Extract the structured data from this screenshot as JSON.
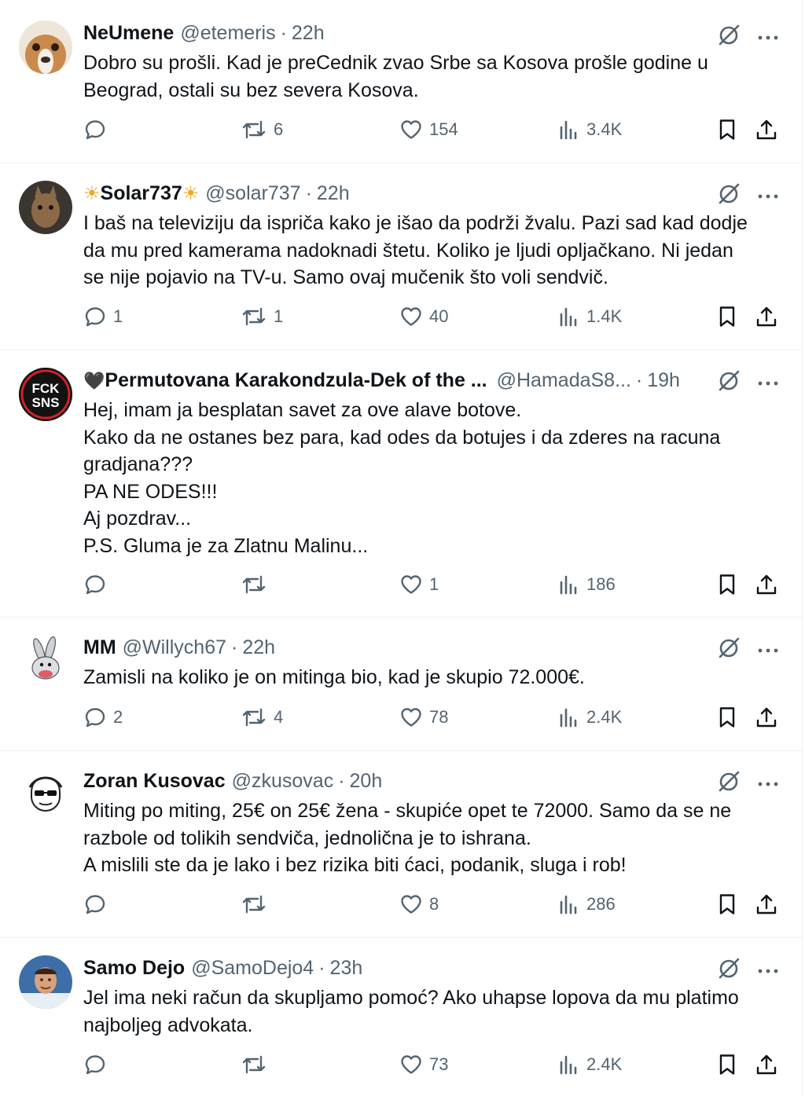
{
  "tweets": [
    {
      "name": "NeUmene",
      "handle": "@etemeris",
      "time": "22h",
      "text": "Dobro su prošli. Kad je preCednik zvao Srbe sa Kosova prošle godine u\nBeograd, ostali su bez severa Kosova.",
      "replies": "",
      "retweets": "6",
      "likes": "154",
      "views": "3.4K"
    },
    {
      "name_prefix": "☀",
      "name": "Solar737",
      "name_suffix": "☀",
      "handle": "@solar737",
      "time": "22h",
      "text": "I baš na televiziju da ispriča kako je išao da podrži žvalu. Pazi sad kad dodje\nda mu pred kamerama nadoknadi štetu. Koliko je ljudi opljačkano. Ni jedan\nse nije pojavio na TV-u. Samo ovaj mučenik što voli sendvič.",
      "replies": "1",
      "retweets": "1",
      "likes": "40",
      "views": "1.4K"
    },
    {
      "name_prefix": "🖤",
      "name": "Permutovana Karakondzula-Dek of the ...",
      "handle": "@HamadaS8...",
      "time": "19h",
      "avatar_text_top": "FCK",
      "avatar_text_bottom": "SNS",
      "text": "Hej, imam ja besplatan savet za ove alave botove.\nKako da ne ostanes bez para, kad odes da botujes i da zderes na racuna\ngradjana???\nPA NE ODES!!!\nAj pozdrav...\nP.S. Gluma je za Zlatnu Malinu...",
      "replies": "",
      "retweets": "",
      "likes": "1",
      "views": "186"
    },
    {
      "name": "MM",
      "handle": "@Willych67",
      "time": "22h",
      "text": "Zamisli na koliko je on mitinga bio, kad je skupio 72.000€.",
      "replies": "2",
      "retweets": "4",
      "likes": "78",
      "views": "2.4K"
    },
    {
      "name": "Zoran Kusovac",
      "handle": "@zkusovac",
      "time": "20h",
      "text": "Miting po miting, 25€ on 25€ žena - skupiće opet te 72000. Samo da se ne\nrazbole od tolikih sendviča, jednolična je to ishrana.\nA mislili ste da je lako i bez rizika biti ćaci, podanik, sluga i rob!",
      "replies": "",
      "retweets": "",
      "likes": "8",
      "views": "286"
    },
    {
      "name": "Samo Dejo",
      "handle": "@SamoDejo4",
      "time": "23h",
      "text": "Jel ima neki račun da skupljamo pomoć? Ako uhapse lopova da mu platimo\nnajboljeg advokata.",
      "replies": "",
      "retweets": "",
      "likes": "73",
      "views": "2.4K"
    }
  ],
  "colors": {
    "text": "#0f1419",
    "muted": "#536471",
    "border": "#eff3f4"
  }
}
